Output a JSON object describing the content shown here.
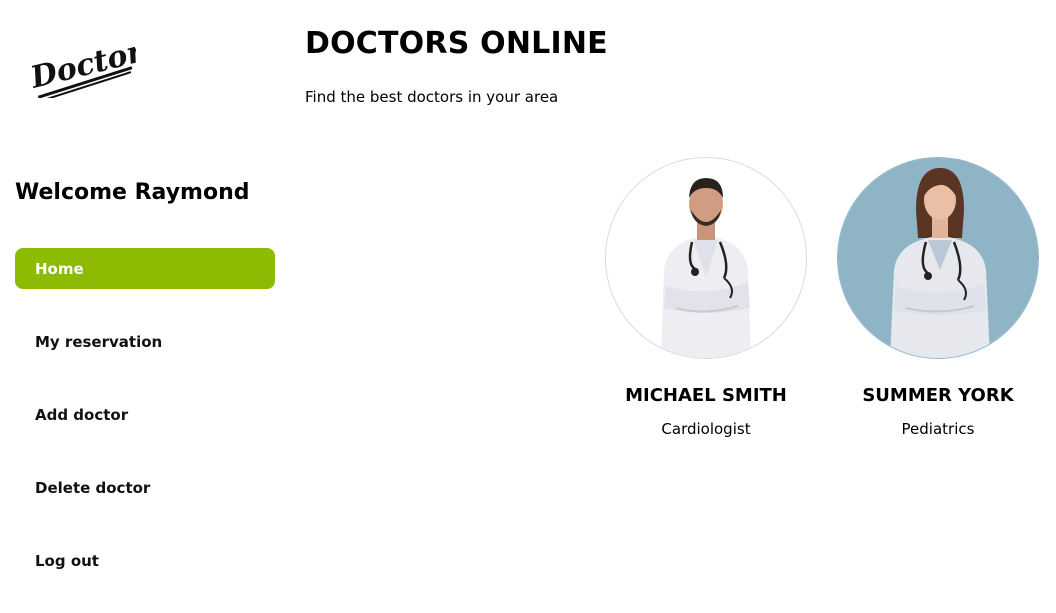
{
  "brand": {
    "logo_text": "Doctors"
  },
  "header": {
    "title": "DOCTORS ONLINE",
    "subtitle": "Find the best doctors in your area"
  },
  "sidebar": {
    "welcome": "Welcome Raymond",
    "items": [
      {
        "label": "Home",
        "active": true
      },
      {
        "label": "My reservation"
      },
      {
        "label": "Add doctor"
      },
      {
        "label": "Delete doctor"
      },
      {
        "label": "Log out"
      }
    ]
  },
  "doctors": [
    {
      "name": "MICHAEL SMITH",
      "specialty": "Cardiologist"
    },
    {
      "name": "SUMMER YORK",
      "specialty": "Pediatrics"
    }
  ],
  "colors": {
    "accent": "#8dba02",
    "photo_bg_2": "#8fb4c6"
  }
}
